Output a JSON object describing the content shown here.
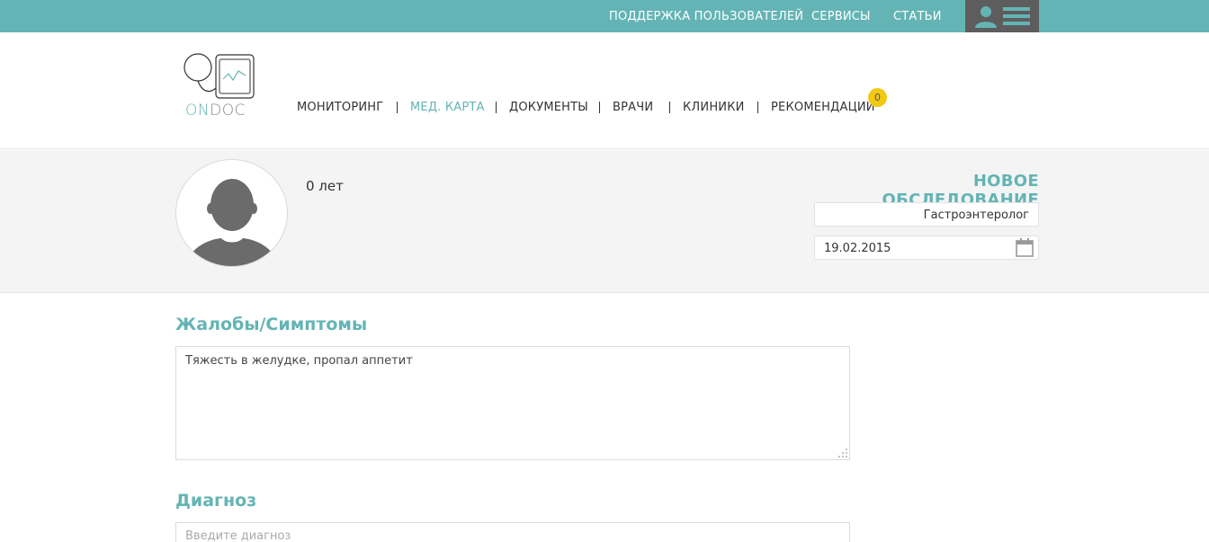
{
  "topbar": {
    "links": [
      "ПОДДЕРЖКА ПОЛЬЗОВАТЕЛЕЙ",
      "СЕРВИСЫ",
      "СТАТЬИ"
    ]
  },
  "logo": {
    "on": "ON",
    "doc": "DOC"
  },
  "nav": {
    "items": [
      "МОНИТОРИНГ",
      "МЕД. КАРТА",
      "ДОКУМЕНТЫ",
      "ВРАЧИ",
      "КЛИНИКИ",
      "РЕКОМЕНДАЦИИ"
    ],
    "active_index": 1,
    "badge": "0"
  },
  "profile": {
    "age": "0 лет"
  },
  "exam": {
    "title": "НОВОЕ ОБСЛЕДОВАНИЕ",
    "specialist": "Гастроэнтеролог",
    "date": "19.02.2015"
  },
  "complaints": {
    "title": "Жалобы/Симптомы",
    "value": "Тяжесть в желудке, пропал аппетит"
  },
  "diagnosis": {
    "title": "Диагноз",
    "placeholder": "Введите диагноз"
  },
  "colors": {
    "accent": "#64b4b5",
    "badge": "#f2c811",
    "user_button": "#5d5d5d"
  }
}
